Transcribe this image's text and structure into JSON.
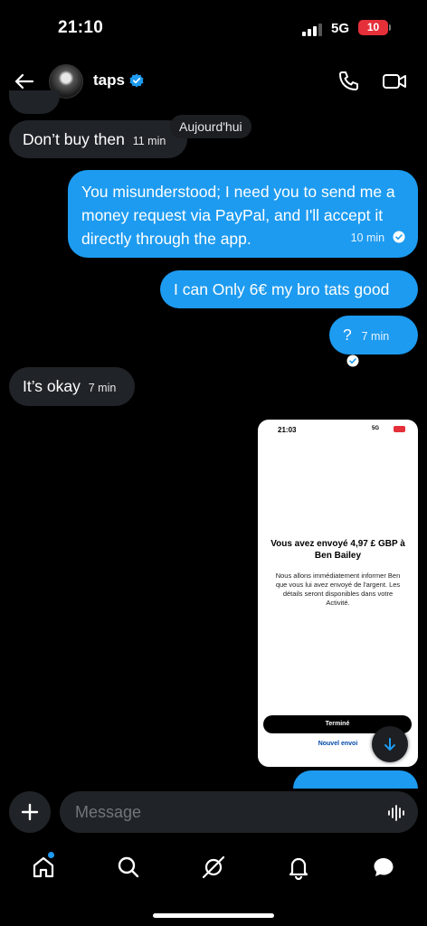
{
  "status_bar": {
    "time": "21:10",
    "network": "5G",
    "battery": "10"
  },
  "header": {
    "contact_name": "taps"
  },
  "date_divider": "Aujourd'hui",
  "messages": [
    {
      "direction": "in",
      "text": "Don’t buy then",
      "time": "11 min"
    },
    {
      "direction": "out",
      "text": "You misunderstood; I need you to send me a money request via PayPal, and I'll accept it directly through the app.",
      "time": "10 min"
    },
    {
      "direction": "out",
      "text": "I can Only 6€ my bro tats good",
      "time": ""
    },
    {
      "direction": "out",
      "text": "?",
      "time": "7 min"
    },
    {
      "direction": "in",
      "text": "It’s okay",
      "time": "7 min"
    }
  ],
  "image_message": {
    "screen_time": "21:03",
    "screen_network": "5G",
    "title": "Vous avez envoyé 4,97 £ GBP à Ben Bailey",
    "body": "Nous allons immédiatement informer Ben que vous lui avez envoyé de l'argent. Les détails seront disponibles dans votre Activité.",
    "done_label": "Terminé",
    "new_send_label": "Nouvel envoi"
  },
  "composer": {
    "placeholder": "Message"
  },
  "colors": {
    "accent": "#1d9bf0",
    "incoming_bubble": "#202327",
    "background": "#000000",
    "battery_low": "#e5303a"
  },
  "icons": {
    "back": "arrow-left-icon",
    "verified": "verified-badge-icon",
    "call": "phone-icon",
    "video": "video-camera-icon",
    "plus": "plus-icon",
    "voice": "voice-wave-icon",
    "scroll": "arrow-down-icon",
    "nav": [
      "home-icon",
      "search-icon",
      "grok-icon",
      "bell-icon",
      "messages-icon"
    ]
  }
}
